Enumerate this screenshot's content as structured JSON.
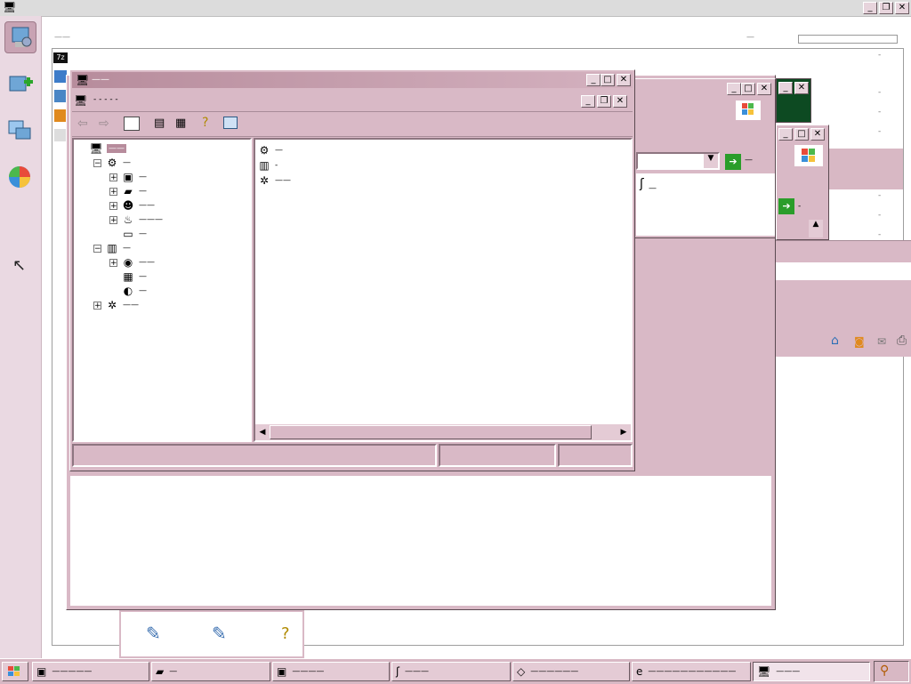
{
  "outer_window": {
    "caption_buttons": [
      "_",
      "❐",
      "✕"
    ]
  },
  "launcher": {
    "icons": [
      "server-manager-icon",
      "add-roles-icon",
      "remote-desktop-icon",
      "windows-media-icon"
    ]
  },
  "background_page": {
    "header_left": "——",
    "header_mid": "—",
    "right_list": [
      "-",
      "-",
      "-",
      "-",
      "-",
      "-",
      "-",
      "-"
    ]
  },
  "main_window": {
    "title": "——",
    "inner_title": "- -  -  -  -",
    "toolbar": [
      "back-icon",
      "forward-icon",
      "show-hide-tree-icon",
      "properties-icon",
      "export-icon",
      "help-icon",
      "action-pane-icon"
    ],
    "tree": [
      {
        "label": "——",
        "depth": 0,
        "expander": "",
        "icon": "computer-icon",
        "selected": true
      },
      {
        "label": "—",
        "depth": 1,
        "expander": "−",
        "icon": "system-tools-icon"
      },
      {
        "label": "—",
        "depth": 2,
        "expander": "+",
        "icon": "event-viewer-icon"
      },
      {
        "label": "—",
        "depth": 2,
        "expander": "+",
        "icon": "shared-folders-icon"
      },
      {
        "label": "——",
        "depth": 2,
        "expander": "+",
        "icon": "users-groups-icon"
      },
      {
        "label": "———",
        "depth": 2,
        "expander": "+",
        "icon": "performance-icon"
      },
      {
        "label": "—",
        "depth": 2,
        "expander": "",
        "icon": "device-manager-icon"
      },
      {
        "label": "—",
        "depth": 1,
        "expander": "−",
        "icon": "storage-icon"
      },
      {
        "label": "——",
        "depth": 2,
        "expander": "+",
        "icon": "removable-storage-icon"
      },
      {
        "label": "—",
        "depth": 2,
        "expander": "",
        "icon": "defragmenter-icon"
      },
      {
        "label": "—",
        "depth": 2,
        "expander": "",
        "icon": "disk-management-icon"
      },
      {
        "label": "——",
        "depth": 1,
        "expander": "+",
        "icon": "services-apps-icon"
      }
    ],
    "list_items": [
      {
        "label": "—",
        "icon": "system-tools-icon"
      },
      {
        "label": "-",
        "icon": "storage-icon"
      },
      {
        "label": "——",
        "icon": "services-apps-icon"
      }
    ],
    "status": [
      "",
      "",
      ""
    ]
  },
  "right_windows": {
    "go_label": "—",
    "go_label2": "-"
  },
  "bottom_strip": {
    "icons": [
      "paint-icon",
      "paint-icon",
      "help-doc-icon"
    ]
  },
  "taskbar": {
    "start_icon": "windows-flag-icon",
    "tasks": [
      {
        "label": "—————",
        "icon": "server-manager-icon"
      },
      {
        "label": "—",
        "icon": "folder-icon"
      },
      {
        "label": "————",
        "icon": "server-manager-icon"
      },
      {
        "label": "———",
        "icon": "tool-icon"
      },
      {
        "label": "——————",
        "icon": "tag-icon"
      },
      {
        "label": "———————————",
        "icon": "ie-icon"
      },
      {
        "label": "———",
        "icon": "computer-icon",
        "active": true
      }
    ],
    "tray_icon": "search-icon"
  }
}
